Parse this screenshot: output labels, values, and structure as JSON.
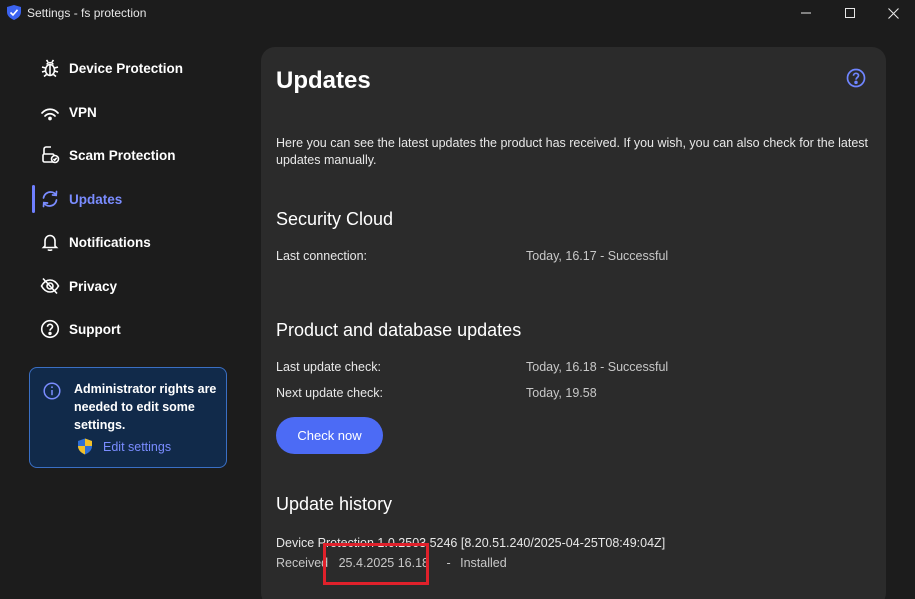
{
  "window": {
    "title": "Settings - fs protection",
    "controls": [
      "minimize",
      "maximize",
      "close"
    ]
  },
  "sidebar": {
    "items": [
      {
        "label": "Device Protection",
        "icon": "bug-icon",
        "active": false
      },
      {
        "label": "VPN",
        "icon": "wifi-icon",
        "active": false
      },
      {
        "label": "Scam Protection",
        "icon": "scam-protection-icon",
        "active": false
      },
      {
        "label": "Updates",
        "icon": "refresh-icon",
        "active": true
      },
      {
        "label": "Notifications",
        "icon": "bell-icon",
        "active": false
      },
      {
        "label": "Privacy",
        "icon": "eye-slash-icon",
        "active": false
      },
      {
        "label": "Support",
        "icon": "help-circle-icon",
        "active": false
      }
    ],
    "admin_notice": {
      "text": "Administrator rights are needed to edit some settings.",
      "link": "Edit settings"
    }
  },
  "main": {
    "title": "Updates",
    "intro": "Here you can see the latest updates the product has received. If you wish, you can also check for the latest updates manually.",
    "security_cloud": {
      "heading": "Security Cloud",
      "last_connection_label": "Last connection:",
      "last_connection_value": "Today, 16.17 - Successful"
    },
    "product_updates": {
      "heading": "Product and database updates",
      "last_check_label": "Last update check:",
      "last_check_value": "Today, 16.18 - Successful",
      "next_check_label": "Next update check:",
      "next_check_value": "Today, 19.58",
      "check_button": "Check now"
    },
    "history": {
      "heading": "Update history",
      "entry_title": "Device Protection 1.0.2503.5246 [8.20.51.240/2025-04-25T08:49:04Z]",
      "entry_received_label": "Received",
      "entry_date": "25.4.2025 16.18",
      "entry_separator": "-",
      "entry_status": "Installed"
    }
  },
  "colors": {
    "background": "#1c1c1c",
    "panel": "#2b2b2b",
    "accent": "#4c6bf5",
    "active_text": "#7a8cff",
    "highlight": "#e0212b"
  }
}
